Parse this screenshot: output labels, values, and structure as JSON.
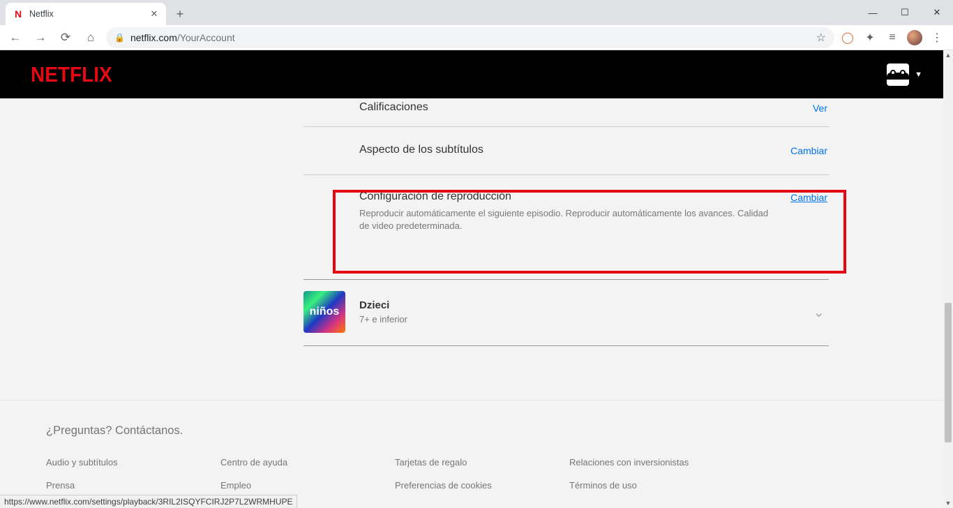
{
  "browser": {
    "tab_title": "Netflix",
    "url_domain": "netflix.com",
    "url_path": "/YourAccount"
  },
  "header": {
    "logo_text": "NETFLIX"
  },
  "settings": {
    "row0": {
      "title": "Calificaciones",
      "action": "Ver"
    },
    "row1": {
      "title": "Aspecto de los subtítulos",
      "action": "Cambiar"
    },
    "row2": {
      "title": "Configuración de reproducción",
      "desc": "Reproducir automáticamente el siguiente episodio. Reproducir automáticamente los avances. Calidad de video predeterminada.",
      "action": "Cambiar"
    }
  },
  "profile": {
    "avatar_label": "niños",
    "name": "Dzieci",
    "sub": "7+ e inferior"
  },
  "footer": {
    "question": "¿Preguntas? Contáctanos.",
    "links": {
      "c0r0": "Audio y subtítulos",
      "c1r0": "Centro de ayuda",
      "c2r0": "Tarjetas de regalo",
      "c3r0": "Relaciones con inversionistas",
      "c0r1": "Prensa",
      "c1r1": "Empleo",
      "c2r1": "Preferencias de cookies",
      "c3r1": "Términos de uso"
    }
  },
  "status_url": "https://www.netflix.com/settings/playback/3RIL2ISQYFCIRJ2P7L2WRMHUPE"
}
